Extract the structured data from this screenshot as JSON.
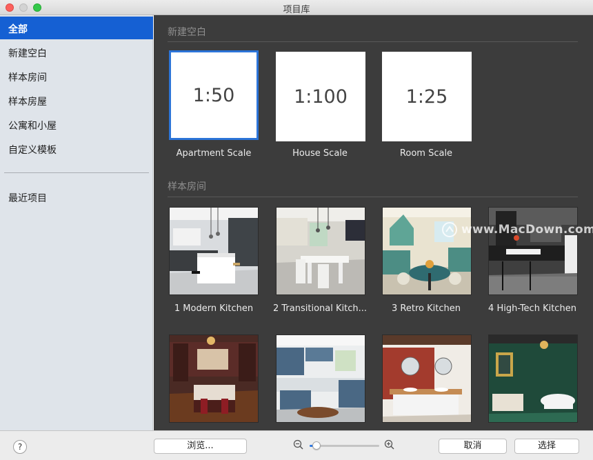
{
  "window": {
    "title": "项目库"
  },
  "sidebar": {
    "items": [
      {
        "label": "全部",
        "selected": true
      },
      {
        "label": "新建空白"
      },
      {
        "label": "样本房间"
      },
      {
        "label": "样本房屋"
      },
      {
        "label": "公寓和小屋"
      },
      {
        "label": "自定义模板"
      }
    ],
    "recent": {
      "label": "最近项目"
    }
  },
  "blank_section": {
    "title": "新建空白",
    "tiles": [
      {
        "scale": "1:50",
        "label": "Apartment Scale",
        "selected": true
      },
      {
        "scale": "1:100",
        "label": "House Scale"
      },
      {
        "scale": "1:25",
        "label": "Room Scale"
      }
    ]
  },
  "sample_section": {
    "title": "样本房间",
    "items": [
      {
        "label": "1 Modern Kitchen"
      },
      {
        "label": "2 Transitional Kitch..."
      },
      {
        "label": "3 Retro Kitchen"
      },
      {
        "label": "4 High-Tech Kitchen"
      },
      {
        "label": ""
      },
      {
        "label": ""
      },
      {
        "label": ""
      },
      {
        "label": ""
      }
    ]
  },
  "watermark": {
    "text": "www.MacDown.com"
  },
  "bottom": {
    "help_label": "?",
    "browse_label": "浏览...",
    "cancel_label": "取消",
    "choose_label": "选择",
    "zoom_level": 0.1
  },
  "icons": {
    "help": "question-mark-icon",
    "zoom_out": "zoom-out-icon",
    "zoom_in": "zoom-in-icon",
    "watermark_logo": "macdown-logo-icon"
  },
  "colors": {
    "accent": "#1560d3",
    "content_bg": "#3c3c3c",
    "sidebar_bg": "#dfe4ea",
    "tile_border_selected": "#2c74d8"
  }
}
